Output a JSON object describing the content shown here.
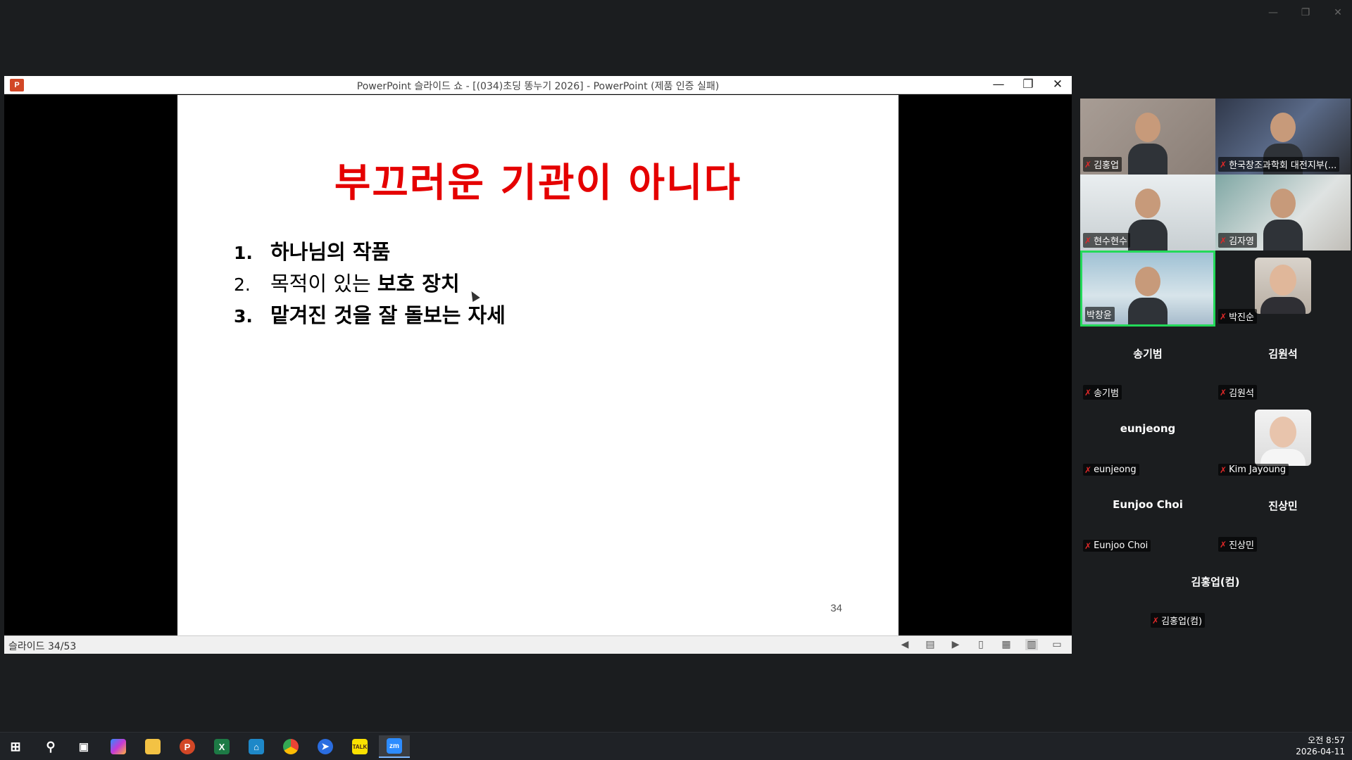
{
  "ppt_window": {
    "title": "PowerPoint 슬라이드 쇼 - [(034)초딩 똥누기 2026] - PowerPoint (제품 인증 실패)",
    "logo_text": "P"
  },
  "slide": {
    "title": "부끄러운 기관이 아니다",
    "items": [
      {
        "num": "1.",
        "pre": "",
        "bold": "하나님의 작품"
      },
      {
        "num": "2.",
        "pre": "목적이 있는 ",
        "bold": "보호 장치"
      },
      {
        "num": "3.",
        "pre": "",
        "bold": "맡겨진 것을 잘 돌보는 자세"
      }
    ],
    "page_number": "34"
  },
  "status_bar": {
    "slide_info": "슬라이드 34/53"
  },
  "participants": [
    {
      "name": "김홍업",
      "muted": true
    },
    {
      "name": "한국창조과학회 대전지부(...",
      "muted": true
    },
    {
      "name": "현수현수",
      "muted": true
    },
    {
      "name": "김자영",
      "muted": true
    },
    {
      "name": "박창윤",
      "muted": false
    },
    {
      "name": "박진순",
      "muted": true
    },
    {
      "name": "송기범",
      "display": "송기범",
      "muted": true
    },
    {
      "name": "김원석",
      "display": "김원석",
      "muted": true
    },
    {
      "name": "eunjeong",
      "display": "eunjeong",
      "muted": true
    },
    {
      "name": "Kim Jayoung",
      "muted": true
    },
    {
      "name": "Eunjoo Choi",
      "display": "Eunjoo Choi",
      "muted": true
    },
    {
      "name": "진상민",
      "display": "진상민",
      "muted": true
    },
    {
      "name": "김홍업(컴)",
      "display": "김홍업(컴)",
      "muted": true
    }
  ],
  "taskbar": {
    "time": "오전 8:57",
    "date": "2026-04-11",
    "apps": [
      "start",
      "search",
      "task-view",
      "copilot",
      "file-explorer",
      "powerpoint",
      "excel",
      "app-blue",
      "chrome",
      "app-pin",
      "kakaotalk",
      "zoom"
    ],
    "kakao_label": "TALK",
    "zoom_label": "zm"
  }
}
